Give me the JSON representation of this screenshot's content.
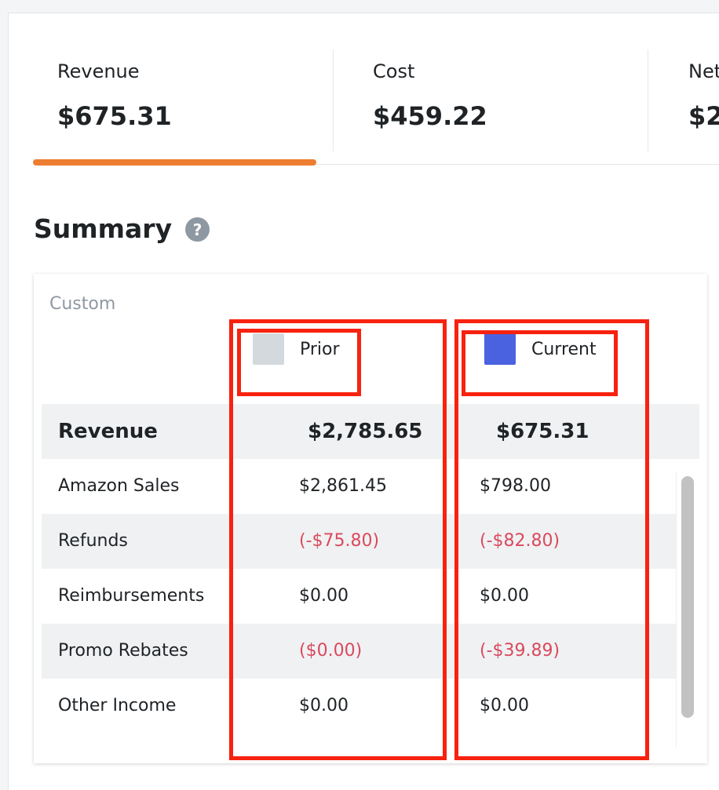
{
  "metrics": [
    {
      "label": "Revenue",
      "value": "$675.31"
    },
    {
      "label": "Cost",
      "value": "$459.22"
    },
    {
      "label": "Net",
      "value": "$2"
    }
  ],
  "summary": {
    "title": "Summary",
    "help_icon": "question-mark-circle-icon",
    "help_symbol": "?"
  },
  "table": {
    "period_label": "Custom",
    "legend": [
      {
        "label": "Prior",
        "color": "#d3d9dc"
      },
      {
        "label": "Current",
        "color": "#4a62e0"
      }
    ],
    "header": {
      "name": "Revenue",
      "prior": "$2,785.65",
      "current": "$675.31"
    },
    "rows": [
      {
        "name": "Amazon Sales",
        "prior": "$2,861.45",
        "current": "$798.00"
      },
      {
        "name": "Refunds",
        "prior": "(-$75.80)",
        "current": "(-$82.80)"
      },
      {
        "name": "Reimbursements",
        "prior": "$0.00",
        "current": "$0.00"
      },
      {
        "name": "Promo Rebates",
        "prior": "($0.00)",
        "current": "(-$39.89)"
      },
      {
        "name": "Other Income",
        "prior": "$0.00",
        "current": "$0.00"
      }
    ]
  },
  "colors": {
    "accent_underline": "#ed7d31",
    "negative_value": "#d94a5c",
    "annotation_box": "#f7220f"
  }
}
